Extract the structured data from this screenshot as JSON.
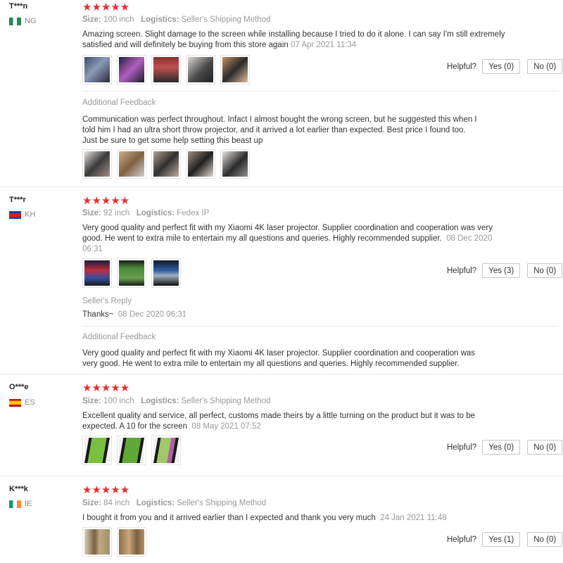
{
  "reviews": [
    {
      "user": "T***n",
      "country": "NG",
      "flag": "ng",
      "stars": "★★★★★",
      "size_label": "Size:",
      "size": "100 inch",
      "logistics_label": "Logistics:",
      "logistics": "Seller's Shipping Method",
      "text_lines": [
        "Amazing screen. Slight damage to the screen while installing because I tried to do it alone. I can say I'm still extremely",
        "satisfied and will definitely be buying from this store again"
      ],
      "date": "07 Apr 2021 11:34",
      "helpful_label": "Helpful?",
      "yes": "Yes (0)",
      "no": "No (0)",
      "additional_label": "Additional Feedback",
      "additional_lines": [
        "Communication was perfect throughout. Infact I almost bought the wrong screen, but he suggested this when I",
        "told him I had an ultra short throw projector, and it arrived a lot earlier than expected. Best price I found too.",
        "Just be sure to get some help setting this beast up"
      ]
    },
    {
      "user": "T***r",
      "country": "KH",
      "flag": "kh",
      "stars": "★★★★★",
      "size_label": "Size:",
      "size": "92 inch",
      "logistics_label": "Logistics:",
      "logistics": "Fedex IP",
      "text_lines": [
        "Very good quality and perfect fit with my Xiaomi 4K laser projector. Supplier coordination and cooperation was very",
        "good. He went to extra mile to entertain my all questions and queries. Highly recommended supplier."
      ],
      "date_a": "08 Dec 2020",
      "date_b": "06:31",
      "helpful_label": "Helpful?",
      "yes": "Yes (3)",
      "no": "No (0)",
      "seller_reply_label": "Seller's Reply",
      "seller_reply": "Thanks~",
      "seller_reply_date": "08 Dec 2020 06:31",
      "additional_label": "Additional Feedback",
      "additional_lines": [
        "Very good quality and perfect fit with my Xiaomi 4K laser projector. Supplier coordination and cooperation was",
        "very good. He went to extra mile to entertain my all questions and queries. Highly recommended supplier."
      ]
    },
    {
      "user": "O***e",
      "country": "ES",
      "flag": "es",
      "stars": "★★★★★",
      "size_label": "Size:",
      "size": "100 inch",
      "logistics_label": "Logistics:",
      "logistics": "Seller's Shipping Method",
      "text_lines": [
        "Excellent quality and service, all perfect, customs made theirs by a little turning on the product but it was to be",
        "expected. A 10 for the screen"
      ],
      "date": "08 May 2021 07:52",
      "helpful_label": "Helpful?",
      "yes": "Yes (0)",
      "no": "No (0)"
    },
    {
      "user": "K***k",
      "country": "IE",
      "flag": "ie",
      "stars": "★★★★★",
      "size_label": "Size:",
      "size": "84 inch",
      "logistics_label": "Logistics:",
      "logistics": "Seller's Shipping Method",
      "text_lines": [
        "I bought it from you and it arrived earlier than I expected and thank you very much"
      ],
      "date": "24 Jan 2021 11:48",
      "helpful_label": "Helpful?",
      "yes": "Yes (1)",
      "no": "No (0)"
    }
  ]
}
